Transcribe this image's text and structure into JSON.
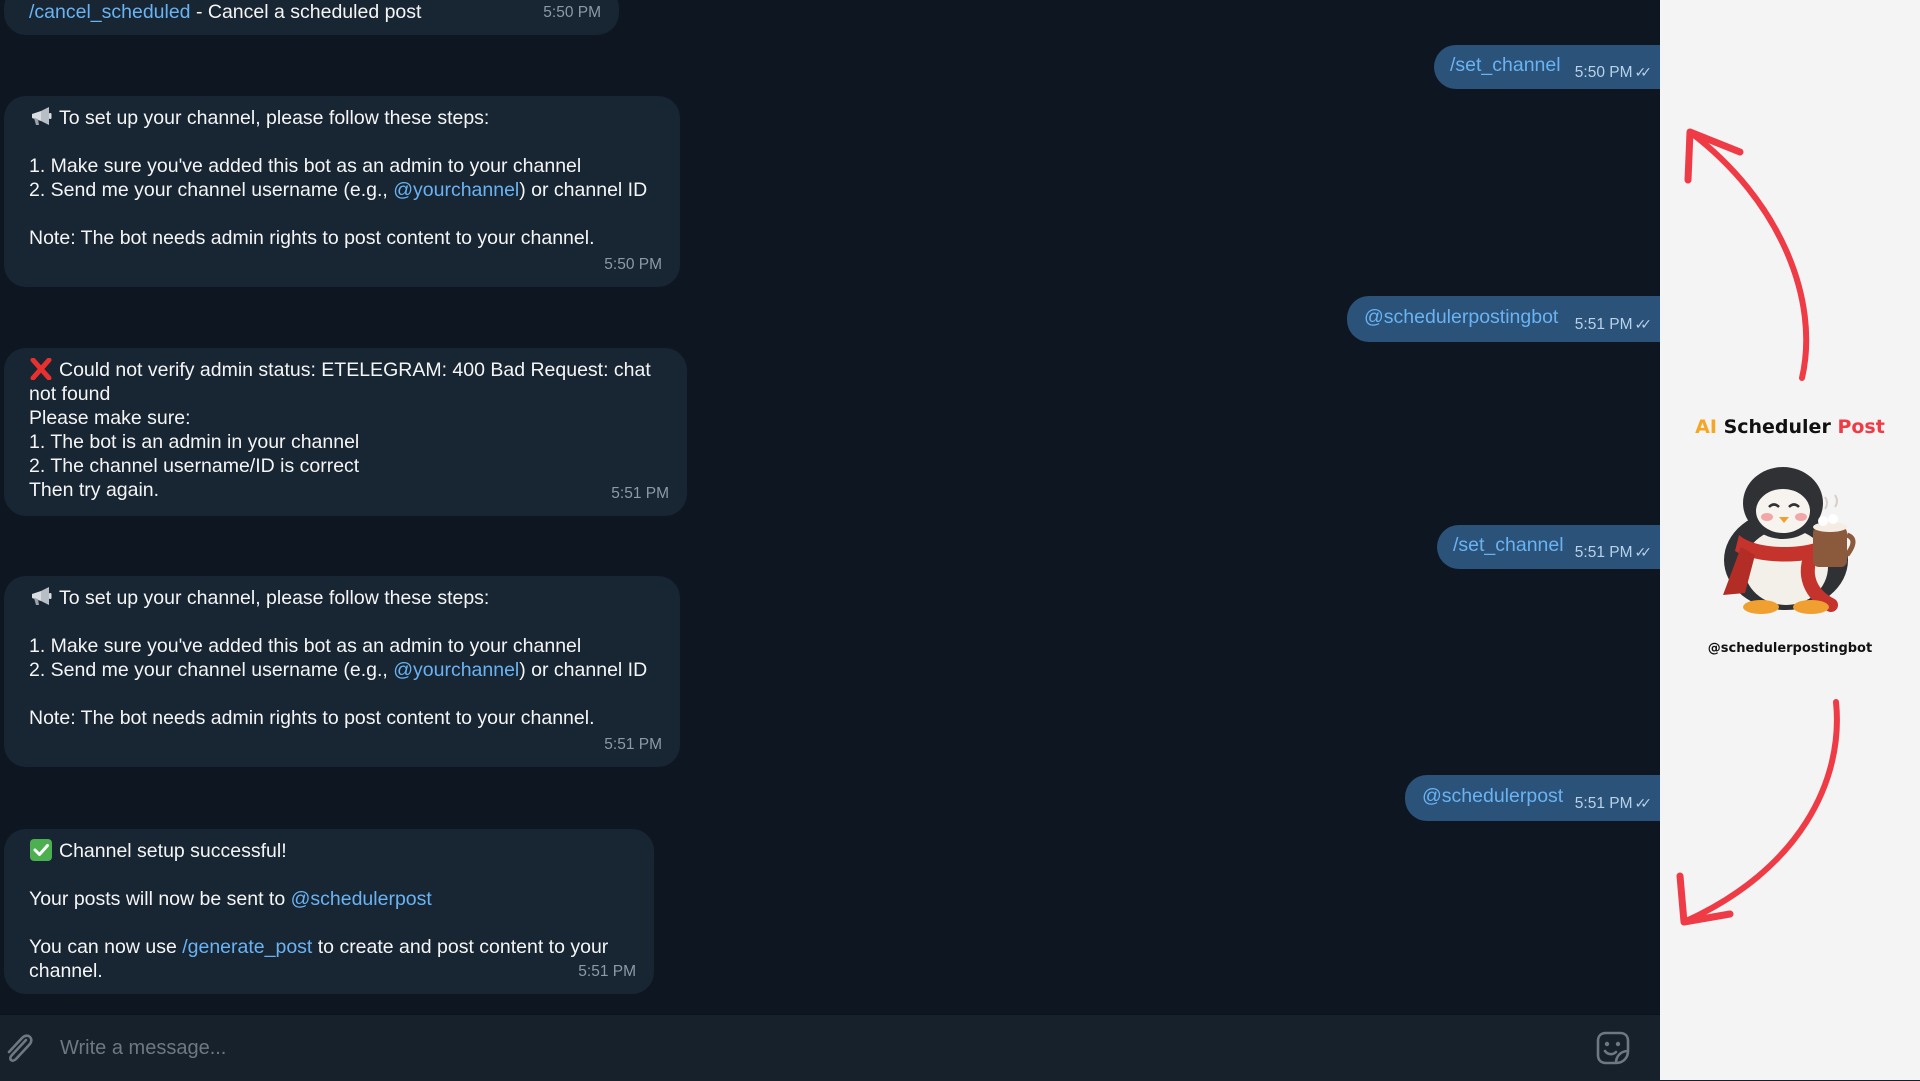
{
  "colors": {
    "chat_background": "#0e1621",
    "incoming_bubble": "#182533",
    "outgoing_bubble": "#2b5278",
    "link": "#6ab3f3",
    "arrow": "#ef3b45",
    "brand_ai": "#f5a623",
    "brand_post": "#ef3b45"
  },
  "messages": {
    "m0": {
      "link": "/cancel_scheduled",
      "text": " - Cancel a scheduled post",
      "time": "5:50 PM"
    },
    "out1": {
      "text": "/set_channel",
      "time": "5:50 PM",
      "status_icon": "double-check"
    },
    "m1": {
      "icon": "megaphone",
      "l1": "To set up your channel, please follow these steps:",
      "l2": "1. Make sure you've added this bot as an admin to your channel",
      "l3a": "2. Send me your channel username (e.g., ",
      "l3link": "@yourchannel",
      "l3b": ") or channel ID",
      "l4": "Note: The bot needs admin rights to post content to your channel.",
      "time": "5:50 PM"
    },
    "out2": {
      "text": "@schedulerpostingbot",
      "time": "5:51 PM",
      "status_icon": "double-check"
    },
    "m2": {
      "icon": "cross-mark",
      "l1": "Could not verify admin status: ETELEGRAM: 400 Bad Request: chat not found",
      "l2": "Please make sure:",
      "l3": "1. The bot is an admin in your channel",
      "l4": "2. The channel username/ID is correct",
      "l5": "Then try again.",
      "time": "5:51 PM"
    },
    "out3": {
      "text": "/set_channel",
      "time": "5:51 PM",
      "status_icon": "double-check"
    },
    "m3": {
      "icon": "megaphone",
      "l1": "To set up your channel, please follow these steps:",
      "l2": "1. Make sure you've added this bot as an admin to your channel",
      "l3a": "2. Send me your channel username (e.g., ",
      "l3link": "@yourchannel",
      "l3b": ") or channel ID",
      "l4": "Note: The bot needs admin rights to post content to your channel.",
      "time": "5:51 PM"
    },
    "out4": {
      "text": "@schedulerpost",
      "time": "5:51 PM",
      "status_icon": "double-check"
    },
    "m4": {
      "icon": "check-mark-button",
      "l1": "Channel setup successful!",
      "l2a": "Your posts will now be sent to ",
      "l2link": "@schedulerpost",
      "l3a": "You can now use ",
      "l3link": "/generate_post",
      "l3b": " to create and post content to your channel.",
      "time": "5:51 PM"
    }
  },
  "composer": {
    "placeholder": "Write a message...",
    "attach_icon": "paperclip",
    "emoji_icon": "sticker-smile"
  },
  "promo": {
    "brand_ai": "AI",
    "brand_scheduler": "Scheduler",
    "brand_post": "Post",
    "handle": "@schedulerpostingbot",
    "mascot": "penguin-with-scarf-and-cocoa-mug",
    "arrows": [
      "curved-arrow-up",
      "curved-arrow-down"
    ]
  }
}
